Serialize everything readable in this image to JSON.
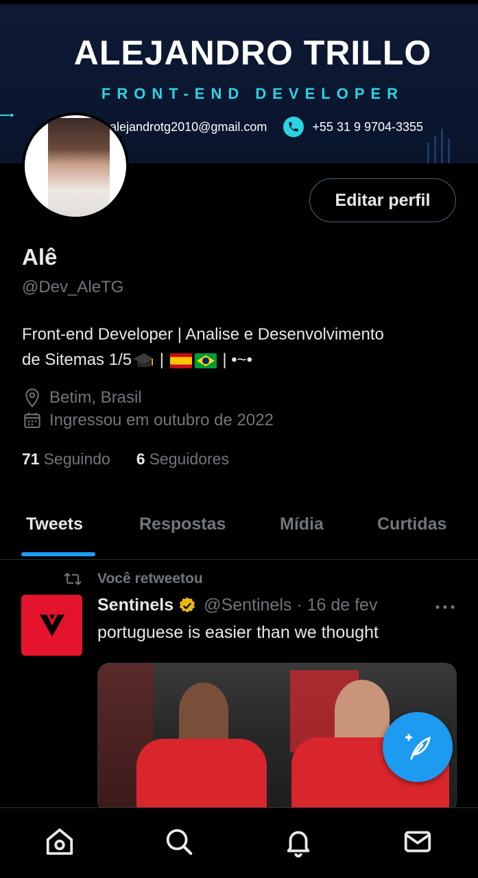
{
  "banner": {
    "name": "ALEJANDRO TRILLO",
    "role": "FRONT-END DEVELOPER",
    "email": "alejandrotg2010@gmail.com",
    "phone": "+55 31  9 9704-3355",
    "accent_color": "#2bd4e4"
  },
  "profile": {
    "edit_button": "Editar perfil",
    "display_name": "Alê",
    "handle": "@Dev_AleTG",
    "bio_line1": "Front-end Developer | Analise e Desenvolvimento",
    "bio_line2_prefix": "de Sitemas 1/5",
    "bio_sep1": " | ",
    "bio_sep2": " | •~•",
    "location": "Betim, Brasil",
    "joined": "Ingressou em outubro de 2022",
    "following_count": "71",
    "following_label": "Seguindo",
    "followers_count": "6",
    "followers_label": "Seguidores"
  },
  "tabs": [
    {
      "label": "Tweets",
      "active": true
    },
    {
      "label": "Respostas",
      "active": false
    },
    {
      "label": "Mídia",
      "active": false
    },
    {
      "label": "Curtidas",
      "active": false
    }
  ],
  "tweet": {
    "retweet_label": "Você retweetou",
    "author": "Sentinels",
    "handle_date": "@Sentinels · 16 de fev",
    "text": "portuguese is easier than we thought"
  },
  "colors": {
    "accent": "#1d9bf0",
    "sentinels_red": "#e3142b",
    "muted": "#71767b"
  },
  "icons": [
    "location-icon",
    "calendar-icon",
    "retweet-icon",
    "verified-icon",
    "more-icon",
    "compose-icon",
    "home-icon",
    "search-icon",
    "notifications-icon",
    "messages-icon"
  ]
}
